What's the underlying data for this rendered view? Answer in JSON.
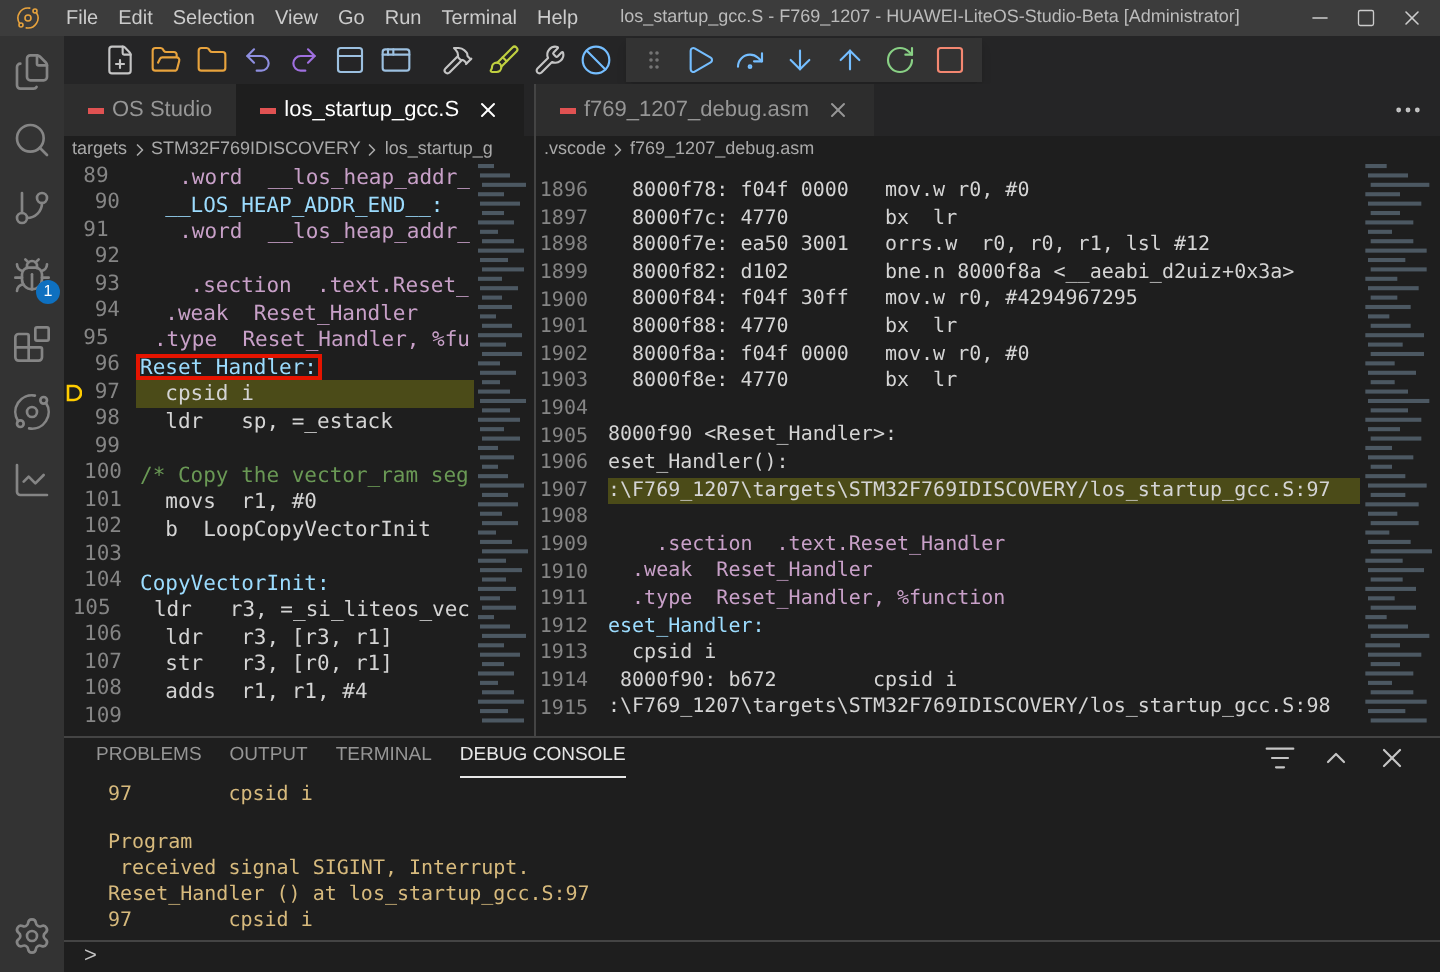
{
  "window": {
    "title": "los_startup_gcc.S - F769_1207 - HUAWEI-LiteOS-Studio-Beta [Administrator]"
  },
  "menu": [
    "File",
    "Edit",
    "Selection",
    "View",
    "Go",
    "Run",
    "Terminal",
    "Help"
  ],
  "activity_bar": {
    "debug_badge": "1"
  },
  "left_editor": {
    "tabs": [
      {
        "label": "OS Studio",
        "selected": false,
        "closable": false
      },
      {
        "label": "los_startup_gcc.S",
        "selected": true,
        "closable": true
      }
    ],
    "breadcrumbs": [
      "targets",
      "STM32F769IDISCOVERY",
      "los_startup_g"
    ],
    "lines": [
      {
        "num": "89",
        "text": "    .word  __los_heap_addr_",
        "kind": "directive",
        "current": false,
        "boxed": false
      },
      {
        "num": "90",
        "text": "  __LOS_HEAP_ADDR_END__:",
        "kind": "label",
        "current": false,
        "boxed": false
      },
      {
        "num": "91",
        "text": "    .word  __los_heap_addr_",
        "kind": "directive",
        "current": false,
        "boxed": false
      },
      {
        "num": "92",
        "current": false
      },
      {
        "num": "93",
        "text": "    .section  .text.Reset_",
        "kind": "directive",
        "current": false,
        "boxed": false
      },
      {
        "num": "94",
        "text": "  .weak  Reset_Handler",
        "kind": "directive",
        "current": false,
        "boxed": false
      },
      {
        "num": "95",
        "text": "  .type  Reset_Handler, %fu",
        "kind": "directive",
        "current": false,
        "boxed": false
      },
      {
        "num": "96",
        "text": "Reset Handler:",
        "kind": "label",
        "current": false,
        "boxed": true
      },
      {
        "num": "97",
        "text": "  cpsid i",
        "kind": "code",
        "current": true,
        "boxed": false
      },
      {
        "num": "98",
        "text": "  ldr   sp, =_estack",
        "kind": "code",
        "current": false,
        "boxed": false
      },
      {
        "num": "99",
        "current": false
      },
      {
        "num": "100",
        "text": "/* Copy the vector_ram seg",
        "kind": "comment",
        "current": false,
        "boxed": false
      },
      {
        "num": "101",
        "text": "  movs  r1, #0",
        "kind": "code",
        "current": false,
        "boxed": false
      },
      {
        "num": "102",
        "text": "  b  LoopCopyVectorInit",
        "kind": "code",
        "current": false,
        "boxed": false
      },
      {
        "num": "103",
        "current": false
      },
      {
        "num": "104",
        "text": "CopyVectorInit:",
        "kind": "label",
        "current": false,
        "boxed": false
      },
      {
        "num": "105",
        "text": "  ldr   r3, =_si_liteos_vec",
        "kind": "code",
        "current": false,
        "boxed": false
      },
      {
        "num": "106",
        "text": "  ldr   r3, [r3, r1]",
        "kind": "code",
        "current": false,
        "boxed": false
      },
      {
        "num": "107",
        "text": "  str   r3, [r0, r1]",
        "kind": "code",
        "current": false,
        "boxed": false
      },
      {
        "num": "108",
        "text": "  adds  r1, r1, #4",
        "kind": "code",
        "current": false,
        "boxed": false
      },
      {
        "num": "109",
        "current": false
      }
    ]
  },
  "right_editor": {
    "tabs": [
      {
        "label": "f769_1207_debug.asm",
        "selected": false,
        "closable": true
      }
    ],
    "breadcrumbs": [
      ".vscode",
      "f769_1207_debug.asm"
    ],
    "lines": [
      {
        "num": "1896",
        "text": "  8000f78: f04f 0000   mov.w r0, #0",
        "kind": "code",
        "current": false
      },
      {
        "num": "1897",
        "text": "  8000f7c: 4770        bx  lr",
        "kind": "code",
        "current": false
      },
      {
        "num": "1898",
        "text": "  8000f7e: ea50 3001   orrs.w  r0, r0, r1, lsl #12",
        "kind": "code",
        "current": false
      },
      {
        "num": "1899",
        "text": "  8000f82: d102        bne.n 8000f8a <__aeabi_d2uiz+0x3a>",
        "kind": "code",
        "current": false
      },
      {
        "num": "1900",
        "text": "  8000f84: f04f 30ff   mov.w r0, #4294967295",
        "kind": "code",
        "current": false
      },
      {
        "num": "1901",
        "text": "  8000f88: 4770        bx  lr",
        "kind": "code",
        "current": false
      },
      {
        "num": "1902",
        "text": "  8000f8a: f04f 0000   mov.w r0, #0",
        "kind": "code",
        "current": false
      },
      {
        "num": "1903",
        "text": "  8000f8e: 4770        bx  lr",
        "kind": "code",
        "current": false
      },
      {
        "num": "1904",
        "current": false
      },
      {
        "num": "1905",
        "text": "8000f90 <Reset_Handler>:",
        "kind": "code",
        "current": false
      },
      {
        "num": "1906",
        "text": "eset_Handler():",
        "kind": "code",
        "current": false
      },
      {
        "num": "1907",
        "text": ":\\F769_1207\\targets\\STM32F769IDISCOVERY/los_startup_gcc.S:97",
        "kind": "code",
        "current": true
      },
      {
        "num": "1908",
        "current": false
      },
      {
        "num": "1909",
        "text": "    .section  .text.Reset_Handler",
        "kind": "directive",
        "current": false
      },
      {
        "num": "1910",
        "text": "  .weak  Reset_Handler",
        "kind": "directive",
        "current": false
      },
      {
        "num": "1911",
        "text": "  .type  Reset_Handler, %function",
        "kind": "directive",
        "current": false
      },
      {
        "num": "1912",
        "text": "eset_Handler:",
        "kind": "label",
        "current": false
      },
      {
        "num": "1913",
        "text": "  cpsid i",
        "kind": "code",
        "current": false
      },
      {
        "num": "1914",
        "text": " 8000f90: b672        cpsid i",
        "kind": "code",
        "current": false
      },
      {
        "num": "1915",
        "text": ":\\F769_1207\\targets\\STM32F769IDISCOVERY/los_startup_gcc.S:98",
        "kind": "code",
        "current": false
      }
    ]
  },
  "panel": {
    "tabs": [
      {
        "label": "PROBLEMS",
        "selected": false
      },
      {
        "label": "OUTPUT",
        "selected": false
      },
      {
        "label": "TERMINAL",
        "selected": false
      },
      {
        "label": "DEBUG CONSOLE",
        "selected": true
      }
    ],
    "console": [
      {
        "kind": "line",
        "text": "97        cpsid i"
      },
      {
        "kind": "blank"
      },
      {
        "kind": "line",
        "text": "Program"
      },
      {
        "kind": "line",
        "text": " received signal SIGINT, Interrupt."
      },
      {
        "kind": "line",
        "text": "Reset_Handler () at los_startup_gcc.S:97"
      },
      {
        "kind": "line",
        "text": "97        cpsid i"
      }
    ],
    "prompt": ">"
  }
}
